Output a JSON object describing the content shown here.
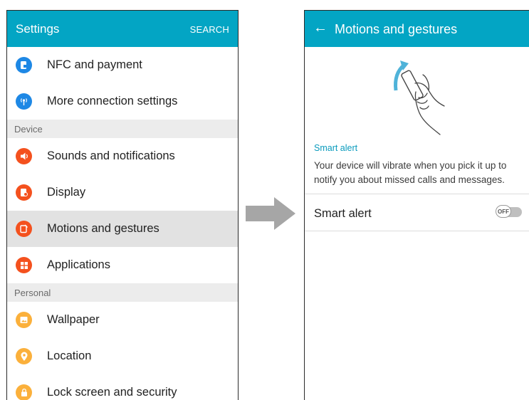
{
  "settings": {
    "title": "Settings",
    "search_label": "SEARCH",
    "items_top": [
      {
        "label": "NFC and payment",
        "icon": "nfc-icon",
        "color": "#1e88e5"
      },
      {
        "label": "More connection settings",
        "icon": "connection-icon",
        "color": "#1e88e5"
      }
    ],
    "section_device": "Device",
    "items_device": [
      {
        "label": "Sounds and notifications",
        "icon": "sound-icon",
        "color": "#f4511e"
      },
      {
        "label": "Display",
        "icon": "display-icon",
        "color": "#f4511e"
      },
      {
        "label": "Motions and gestures",
        "icon": "motion-icon",
        "color": "#f4511e"
      },
      {
        "label": "Applications",
        "icon": "apps-icon",
        "color": "#f4511e"
      }
    ],
    "section_personal": "Personal",
    "items_personal": [
      {
        "label": "Wallpaper",
        "icon": "wallpaper-icon",
        "color": "#fbb03b"
      },
      {
        "label": "Location",
        "icon": "location-icon",
        "color": "#fbb03b"
      },
      {
        "label": "Lock screen and security",
        "icon": "lock-icon",
        "color": "#fbb03b"
      }
    ]
  },
  "motions": {
    "title": "Motions and gestures",
    "section_header": "Smart alert",
    "description": "Your device will vibrate when you pick it up to notify you about missed calls and messages.",
    "smart_alert_label": "Smart alert",
    "toggle_text": "OFF"
  },
  "colors": {
    "appbar": "#03a5c4",
    "accent": "#0a9bbd"
  }
}
